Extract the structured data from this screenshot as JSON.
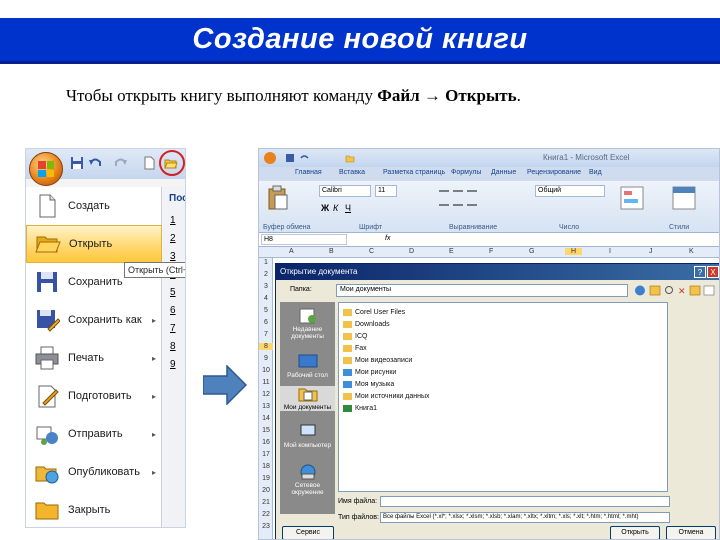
{
  "slide": {
    "title": "Создание новой книги",
    "intro_text": "Чтобы открыть книгу выполняют команду ",
    "intro_command": "Файл → Открыть",
    "intro_end": "."
  },
  "office_menu": {
    "items": [
      {
        "label": "Создать",
        "icon": "new-document-icon"
      },
      {
        "label": "Открыть",
        "icon": "open-folder-icon",
        "active": true
      },
      {
        "label": "Сохранить",
        "icon": "save-icon"
      },
      {
        "label": "Сохранить как",
        "icon": "save-as-icon",
        "submenu": true
      },
      {
        "label": "Печать",
        "icon": "print-icon",
        "submenu": true
      },
      {
        "label": "Подготовить",
        "icon": "prepare-icon",
        "submenu": true
      },
      {
        "label": "Отправить",
        "icon": "send-icon",
        "submenu": true
      },
      {
        "label": "Опубликовать",
        "icon": "publish-icon",
        "submenu": true
      },
      {
        "label": "Закрыть",
        "icon": "close-folder-icon"
      }
    ],
    "recent_header": "Пос",
    "recent_numbers": [
      "1",
      "2",
      "3",
      "4",
      "5",
      "6",
      "7",
      "8",
      "9"
    ],
    "tooltip": "Открыть (Ctrl+O)",
    "submenu_arrow": "▸"
  },
  "excel": {
    "window_title": "Книга1 - Microsoft Excel",
    "tabs": [
      "Главная",
      "Вставка",
      "Разметка страницы",
      "Формулы",
      "Данные",
      "Рецензирование",
      "Вид"
    ],
    "font_name": "Calibri",
    "font_size": "11",
    "number_format": "Общий",
    "group_labels": [
      "Буфер обмена",
      "Шрифт",
      "Выравнивание",
      "Число",
      "Стили"
    ],
    "cell_ref": "H8",
    "fx": "fx",
    "columns": [
      "A",
      "B",
      "C",
      "D",
      "E",
      "F",
      "G",
      "H",
      "I",
      "J",
      "K"
    ],
    "rows": [
      "1",
      "2",
      "3",
      "4",
      "5",
      "6",
      "7",
      "8",
      "9",
      "10",
      "11",
      "12",
      "13",
      "14",
      "15",
      "16",
      "17",
      "18",
      "19",
      "20",
      "21",
      "22",
      "23"
    ]
  },
  "dialog": {
    "title": "Открытие документа",
    "help_btn": "?",
    "close_btn": "X",
    "look_in_label": "Папка:",
    "look_in_value": "Мои документы",
    "places": [
      "Недавние документы",
      "Рабочий стол",
      "Мои документы",
      "Мой компьютер",
      "Сетевое окружение"
    ],
    "files": [
      "Corel User Files",
      "Downloads",
      "ICQ",
      "Fax",
      "Мои видеозаписи",
      "Мои рисунки",
      "Моя музыка",
      "Мои источники данных",
      "Книга1"
    ],
    "file_name_label": "Имя файла:",
    "file_name_value": "",
    "file_type_label": "Тип файлов:",
    "file_type_value": "Все файлы Excel (*.xl*; *.xlsx; *.xlsm; *.xlsb; *.xlam; *.xltx; *.xltm; *.xls; *.xlt; *.htm; *.html; *.mht)",
    "service_btn": "Сервис",
    "open_btn": "Открыть",
    "cancel_btn": "Отмена"
  },
  "colors": {
    "title_bar": "#0033cc",
    "menu_highlight": "#ffd66b",
    "arrow": "#4f81bd",
    "highlight_circle": "#d42020"
  }
}
